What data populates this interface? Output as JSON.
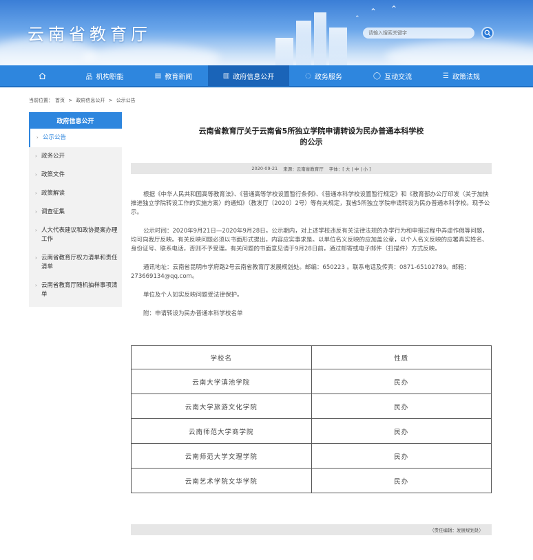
{
  "header": {
    "site_title": "云南省教育厅",
    "search_placeholder": "请输入搜索关键字"
  },
  "nav": [
    {
      "label": "",
      "icon": "home-icon"
    },
    {
      "label": "机构职能",
      "icon": "org-icon"
    },
    {
      "label": "教育新闻",
      "icon": "news-icon"
    },
    {
      "label": "政府信息公开",
      "icon": "building-icon"
    },
    {
      "label": "政务服务",
      "icon": "service-icon"
    },
    {
      "label": "互动交流",
      "icon": "chat-icon"
    },
    {
      "label": "政策法规",
      "icon": "list-icon"
    }
  ],
  "breadcrumb": {
    "prefix": "当前位置：",
    "items": [
      "首页",
      "政府信息公开",
      "公示公告"
    ],
    "separator": ">"
  },
  "sidebar": {
    "title": "政府信息公开",
    "items": [
      {
        "label": "公示公告",
        "active": true
      },
      {
        "label": "政务公开"
      },
      {
        "label": "政策文件"
      },
      {
        "label": "政策解读"
      },
      {
        "label": "调查征集"
      },
      {
        "label": "人大代表建议和政协提案办理工作"
      },
      {
        "label": "云南省教育厅权力清单和责任清单"
      },
      {
        "label": "云南省教育厅随机抽样事项清单"
      }
    ]
  },
  "article": {
    "title_line1": "云南省教育厅关于云南省5所独立学院申请转设为民办普通本科学校",
    "title_line2": "的公示",
    "meta": {
      "date": "2020-09-21",
      "source_label": "来源：",
      "source": "云南省教育厅",
      "font_label": "字体：",
      "font_sizes": "[ 大 | 中 | 小 ]"
    },
    "paragraphs": [
      "根据《中华人民共和国高等教育法》、《普通高等学校设置暂行条例》、《普通本科学校设置暂行规定》和《教育部办公厅印发〈关于加快推进独立学院转设工作的实施方案〉的通知》（教发厅〔2020〕2号）等有关规定，我省5所独立学院申请转设为民办普通本科学校。现予公示。",
      "公示时间：2020年9月21日—2020年9月28日。公示期内，对上述学校违反有关法律法规的办学行为和申报过程中弄虚作假等问题，均可向我厅反映。有关反映问题必须以书面形式提出，内容应实事求是。以单位名义反映的应加盖公章，以个人名义反映的应署真实姓名、身份证号、联系电话，否则不予受理。有关问题的书面意见请于9月28日前，通过邮寄或电子邮件（扫描件）方式反映。",
      "通讯地址：云南省昆明市学府路2号云南省教育厅发展规划处。邮编：650223 。联系电话及传真：0871-65102789。邮箱：273669134@qq.com。",
      "单位及个人如实反映问题受法律保护。",
      "附：申请转设为民办普通本科学校名单"
    ]
  },
  "table": {
    "headers": [
      "学校名",
      "性质"
    ],
    "rows": [
      [
        "云南大学滇池学院",
        "民办"
      ],
      [
        "云南大学旅游文化学院",
        "民办"
      ],
      [
        "云南师范大学商学院",
        "民办"
      ],
      [
        "云南师范大学文理学院",
        "民办"
      ],
      [
        "云南艺术学院文华学院",
        "民办"
      ]
    ]
  },
  "footer": {
    "editor": "（责任编辑：发展规划处）"
  },
  "colors": {
    "nav_bg": "#2e86de",
    "nav_active": "#1a64b8",
    "sidebar_active_text": "#2e86de"
  }
}
